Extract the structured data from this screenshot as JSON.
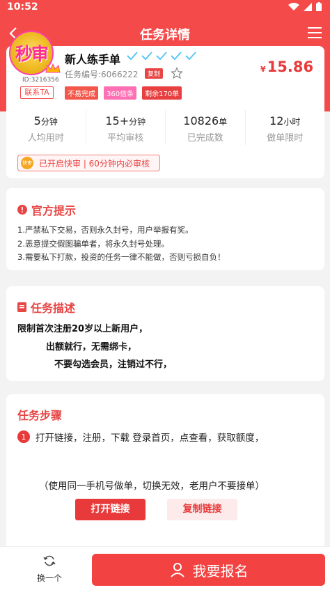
{
  "status_bar": {
    "time": "10:52"
  },
  "nav": {
    "title": "任务详情"
  },
  "task": {
    "avatar_text": "秒审",
    "uid": "ID:3216356",
    "contact_label": "联系TA",
    "title": "新人练手单",
    "task_no": "任务编号:6066222",
    "copy_label": "复制",
    "currency": "¥",
    "price": "15.86",
    "tags": [
      "不易完成",
      "360信条",
      "剩余170单"
    ]
  },
  "stats": [
    {
      "value": "5",
      "unit": "分钟",
      "label": "人均用时"
    },
    {
      "value": "15+",
      "unit": "分钟",
      "label": "平均审核"
    },
    {
      "value": "10826",
      "unit": "单",
      "label": "已完成数"
    },
    {
      "value": "12",
      "unit": "小时",
      "label": "做单限时"
    }
  ],
  "fast_review": {
    "icon_text": "快审",
    "text": "已开启快审 | 60分钟内必审核"
  },
  "official_notice": {
    "title": "官方提示",
    "lines": [
      "1.严禁私下交易，否则永久封号，用户举报有奖。",
      "2.恶意提交假图骗单者，将永久封号处理。",
      "3.需要私下打款，投资的任务一律不能做，否则亏损自负！"
    ]
  },
  "description": {
    "title": "任务描述",
    "lines": [
      "限制首次注册20岁以上新用户，",
      "出额就行，无需绑卡，",
      "不要勾选会员，注销过不行，"
    ]
  },
  "steps": {
    "title": "任务步骤",
    "step1_num": "1",
    "step1_text": "打开链接，注册，下载 登录首页，点查看，获取额度，",
    "note": "（使用同一手机号做单，切换无效，老用户不要接单）",
    "open_link": "打开链接",
    "copy_link": "复制链接"
  },
  "bottom": {
    "switch_label": "换一个",
    "signup_label": "我要报名"
  },
  "colors": {
    "brand_red": "#f44a4a",
    "pink_tag": "#ff6fb3"
  }
}
